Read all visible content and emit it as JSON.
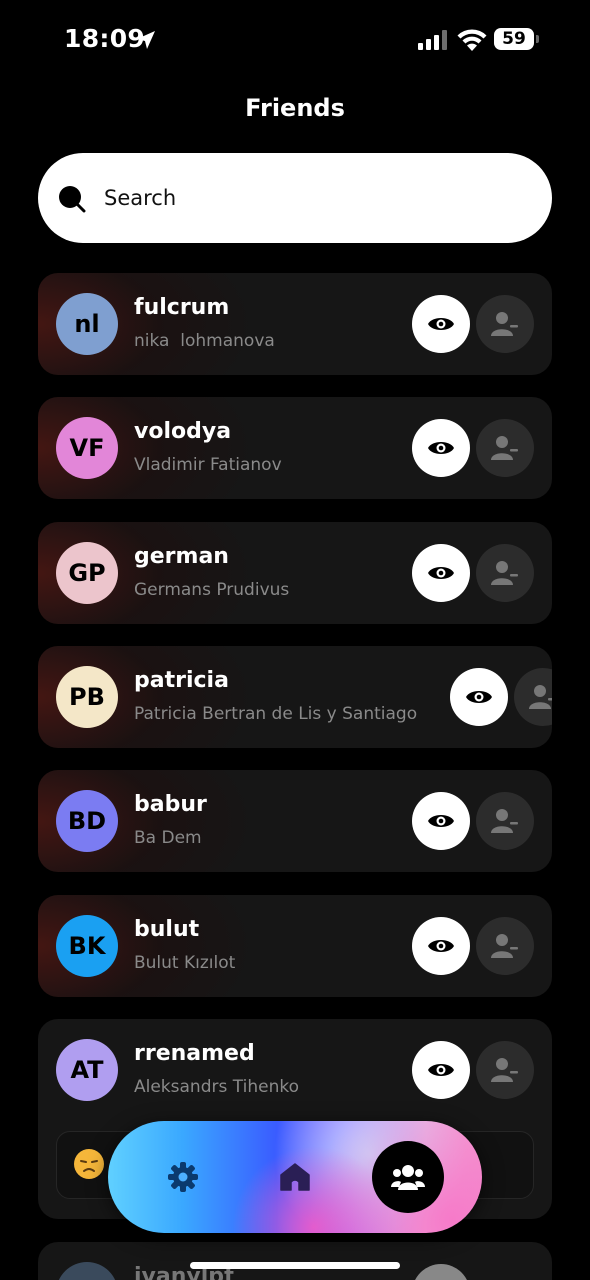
{
  "status_bar": {
    "time": "18:09",
    "battery": "59"
  },
  "page": {
    "title": "Friends"
  },
  "search": {
    "placeholder": "Search"
  },
  "friends": [
    {
      "username": "fulcrum",
      "full_name": "nika  lohmanova",
      "initials": "nl",
      "avatar_color": "#7f9fd0"
    },
    {
      "username": "volodya",
      "full_name": "Vladimir Fatianov",
      "initials": "VF",
      "avatar_color": "#e286d8"
    },
    {
      "username": "german",
      "full_name": "Germans Prudivus",
      "initials": "GP",
      "avatar_color": "#ecc5cc"
    },
    {
      "username": "patricia",
      "full_name": "Patricia Bertran de Lis y Santiago",
      "initials": "PB",
      "avatar_color": "#f4e7c8"
    },
    {
      "username": "babur",
      "full_name": "Ba Dem",
      "initials": "BD",
      "avatar_color": "#7b7cf2"
    },
    {
      "username": "bulut",
      "full_name": "Bulut Kızılot",
      "initials": "BK",
      "avatar_color": "#1aa0f2"
    },
    {
      "username": "rrenamed",
      "full_name": "Aleksandrs Tihenko",
      "initials": "AT",
      "avatar_color": "#b09ef0"
    },
    {
      "username": "ivanylpf",
      "full_name": "",
      "initials": "",
      "avatar_color": "#3a4a5c"
    }
  ],
  "bottom_nav": {
    "items": [
      "settings",
      "home",
      "friends"
    ],
    "active": "friends"
  }
}
